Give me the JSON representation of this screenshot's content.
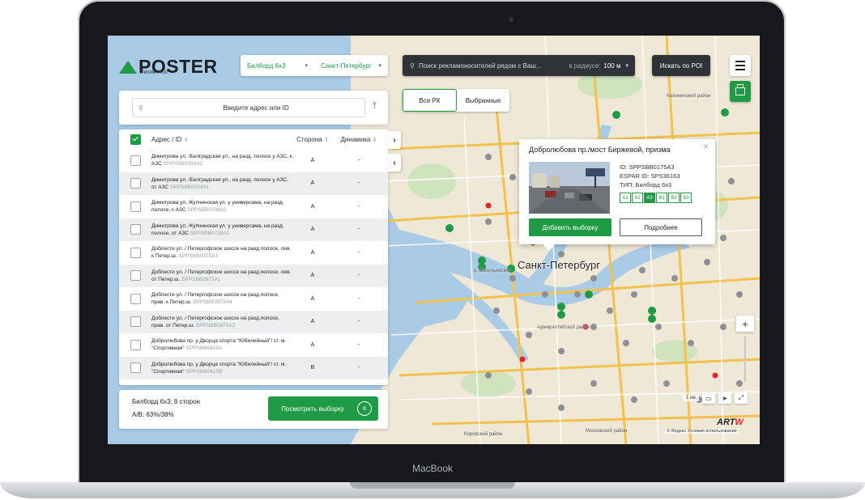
{
  "device": {
    "brand_label": "MacBook"
  },
  "header": {
    "logo_text": "POSTER",
    "logo_sub": "Лисий Нос",
    "format_select": "Билборд 6х3",
    "city_select": "Санкт-Петербург",
    "search_placeholder": "Поиск рекламоносителей рядом с Ваш...",
    "radius_label": "в радиусе:",
    "radius_value": "100 м",
    "poi_button": "Искать по POI"
  },
  "mode_toggle": {
    "all": "Все РК",
    "selected": "Выбранные"
  },
  "address_search": {
    "placeholder": "Введите адрес или ID"
  },
  "table": {
    "columns": {
      "address": "Адрес / ID",
      "side": "Сторона",
      "dynamics": "Динамика"
    },
    "rows": [
      {
        "address": "Димитрова ул. /Белградская ул., на разд. полосе у АЗС, к АЗС",
        "id": "SPPSBB0054A2",
        "side": "A",
        "dynamics": "-"
      },
      {
        "address": "Димитрова ул. /Белградская ул., на разд. полосе у АЗС, от АЗС",
        "id": "SPPSBB0054A1",
        "side": "A",
        "dynamics": "-"
      },
      {
        "address": "Димитрова ул. /Купчинская ул. у универсама, на разд. полосе, к АЗС",
        "id": "SPPSBB0738A2",
        "side": "A",
        "dynamics": "-"
      },
      {
        "address": "Димитрова ул. /Купчинская ул. у универсама, на разд. полосе, от АЗС",
        "id": "SPPSBB0738A1",
        "side": "A",
        "dynamics": "-"
      },
      {
        "address": "Доблести ул. / Петергофское шоссе на разд.полосе, лев. к Петер.ш.",
        "id": "SPPSBB0975A3",
        "side": "A",
        "dynamics": "-"
      },
      {
        "address": "Доблести ул. / Петергофское шоссе на разд.полосе, лев. от Петер.ш.",
        "id": "SPPSBB0975A1",
        "side": "A",
        "dynamics": "-"
      },
      {
        "address": "Доблести ул. / Петергофское шоссе на разд.полосе, прав. к Петер.ш.",
        "id": "SPPSBB0975A4",
        "side": "A",
        "dynamics": "-"
      },
      {
        "address": "Доблести ул. / Петергофское шоссе на разд.полосе, прав. от Петер.ш.",
        "id": "SPPSBB0975A2",
        "side": "A",
        "dynamics": "-"
      },
      {
        "address": "Добролюбова пр. у Дворца спорта \"Юбилейный\"/ ст. м. \"Спортивная\"",
        "id": "SPPSBB0415A",
        "side": "A",
        "dynamics": "-"
      },
      {
        "address": "Добролюбова пр. у Дворца спорта \"Юбилейный\"/ ст. м. \"Спортивная\"",
        "id": "SPPSBB0415B",
        "side": "B",
        "dynamics": "-"
      }
    ]
  },
  "summary": {
    "line1": "Билборд 6х3: 8 сторон",
    "line2": "A/B: 63%/38%",
    "view_button": "Посмотреть выборку",
    "count": "8"
  },
  "popup": {
    "title": "Добролюбова пр./мост Биржевой, призма",
    "id_line": "ID: SPPSBB0175A3",
    "espar_line": "ESPAR ID: SPS36163",
    "type_line": "ТИП: Билборд 6х3",
    "sides": [
      "A1",
      "A2",
      "A3",
      "B1",
      "B2",
      "B3"
    ],
    "active_side": "A3",
    "add_button": "Добавить выборку",
    "more_button": "Подробнее"
  },
  "map": {
    "city_label": "Санкт-Петербург",
    "labels": [
      "Калининский район",
      "о. Васильевский",
      "Адмиралтейский район",
      "Кировский район",
      "Московский район"
    ],
    "scale_label": "1 км",
    "attribution": "© Яндекс Условия использования",
    "logo": "ARTW"
  },
  "colors": {
    "accent": "#1f9a45",
    "dark": "#2f3337"
  }
}
